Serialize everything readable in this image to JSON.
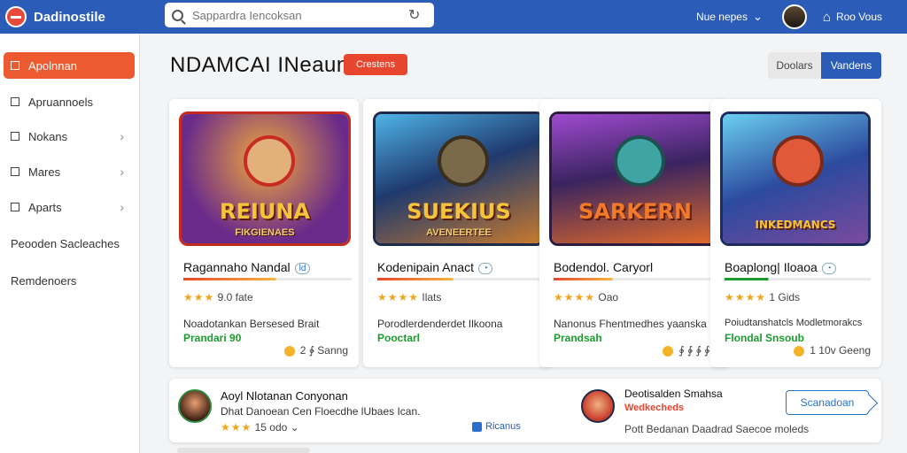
{
  "topbar": {
    "app_name": "Dadinostile",
    "search_placeholder": "Sappardra Iencoksan",
    "link": "Nue nepes",
    "home_label": "Roo Vous"
  },
  "sidebar": {
    "items": [
      {
        "label": "Apolnnan",
        "active": true
      },
      {
        "label": "Apruannoels",
        "active": false
      },
      {
        "label": "Nokans",
        "active": false
      },
      {
        "label": "Mares",
        "active": false
      },
      {
        "label": "Aparts",
        "active": false
      }
    ],
    "plain_items": [
      "Peooden Sacleaches",
      "Remdenoers"
    ]
  },
  "main": {
    "title": "NDAMCAI INeaun",
    "title_badge": "Crestens",
    "segments": [
      "Doolars",
      "Vandens"
    ]
  },
  "cards": [
    {
      "title": "Ragannaho Nandal",
      "tag": "ld",
      "art_title": "REIUNA",
      "art_sub": "FIKGIENAES",
      "rating": "9.0 fate",
      "stars": "★★★",
      "desc": "Noadotankan Bersesed Brait",
      "price": "Prandari 90",
      "foot": "2  ∳ Sanng",
      "colors": {
        "bg1": "#6a2a8a",
        "bg2": "#e07a2a",
        "fig": "#e2b07a"
      }
    },
    {
      "title": "Kodenipain Anact",
      "tag": "◔",
      "art_title": "SUEKIUS",
      "art_sub": "AVENEERTEE",
      "rating": "Ilats",
      "stars": "★★★★",
      "desc": "Porodlerdenderdet Ilkoona",
      "price": "Pooctarl",
      "foot": "",
      "colors": {
        "bg1": "#1f3a6e",
        "bg2": "#c87a2e",
        "fig": "#7a6a4a"
      }
    },
    {
      "title": "Bodendol. Caryorl",
      "tag": "",
      "art_title": "SARKERN",
      "art_sub": "",
      "rating": "Oao",
      "stars": "★★★★",
      "desc": "Nanonus Fhentmedhes yaanska",
      "price": "Prandsah",
      "foot": "∳ ∳ ∳ ∳ ∳",
      "colors": {
        "bg1": "#3a2460",
        "bg2": "#e06a2a",
        "fig": "#3fa4a4"
      }
    },
    {
      "title": "Boaplong| Iloaoa",
      "tag": "◔",
      "art_title": "INKEDMANCS",
      "art_sub": "",
      "rating": "1 Gids",
      "stars": "★★★★",
      "desc": "Poiudtanshatcls Modletmorakcs",
      "price": "Flondal  Snsoub",
      "foot": "1 10v  Geeng",
      "colors": {
        "bg1": "#2c4a9e",
        "bg2": "#7a4a9e",
        "fig": "#e05a3a"
      }
    }
  ],
  "list": {
    "row1": {
      "title": "Aoyl Nlotanan Conyonan",
      "sub": "Dhat Danoean Cen Floecdhe lUbaes Ican.",
      "rating": "15 odo",
      "stars": "★★★",
      "badge": "Ricanus"
    },
    "row2": {
      "title": "Deotisalden Smahsa",
      "sub": "Wedkecheds",
      "meta": "Pott Bedanan Daadrad Saecoe moleds"
    },
    "button": "Scanadoan"
  }
}
